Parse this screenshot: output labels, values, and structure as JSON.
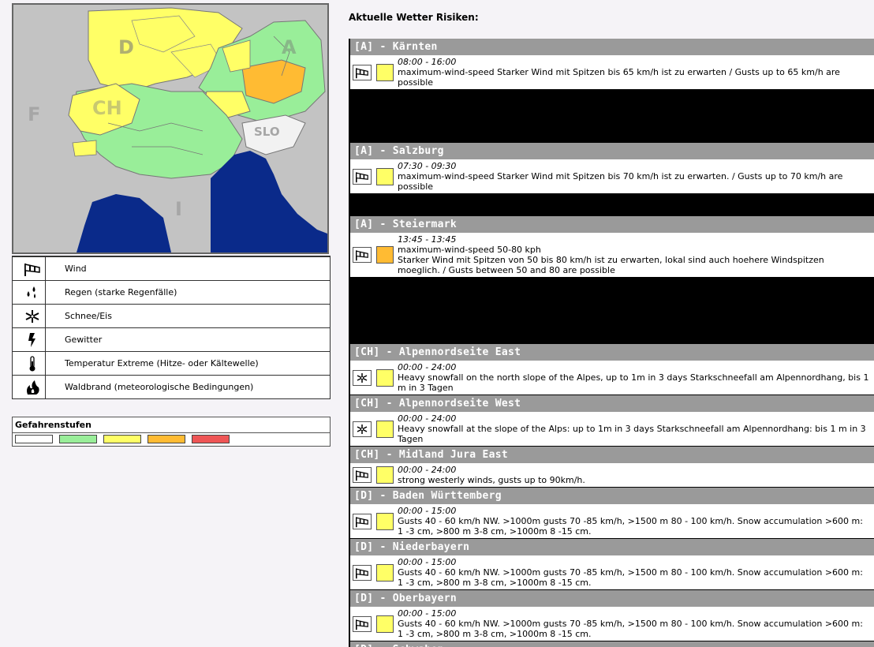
{
  "map": {
    "labels": [
      "D",
      "A",
      "F",
      "CH",
      "SLO",
      "I"
    ]
  },
  "legend": [
    {
      "icon": "windsock-icon",
      "label": "Wind"
    },
    {
      "icon": "rain-icon",
      "label": "Regen (starke Regenfälle)"
    },
    {
      "icon": "snowflake-icon",
      "label": "Schnee/Eis"
    },
    {
      "icon": "lightning-icon",
      "label": "Gewitter"
    },
    {
      "icon": "thermometer-icon",
      "label": "Temperatur Extreme (Hitze- oder Kältewelle)"
    },
    {
      "icon": "forest-fire-icon",
      "label": "Waldbrand (meteorologische Bedingungen)"
    }
  ],
  "levels": {
    "title": "Gefahrenstufen",
    "colors": [
      "#ffffff",
      "#99ee99",
      "#ffff66",
      "#ffbb33",
      "#ee5555"
    ]
  },
  "risks": {
    "title": "Aktuelle Wetter Risiken:",
    "regions": [
      {
        "name": "[A] - Kärnten",
        "icon": "windsock-icon",
        "level_color": "#ffff66",
        "time": "08:00  -  16:00",
        "lines": [
          "maximum-wind-speed Starker Wind mit Spitzen bis 65 km/h ist zu erwarten / Gusts up to 65 km/h are possible"
        ]
      },
      {
        "name": "[A] - Salzburg",
        "icon": "windsock-icon",
        "level_color": "#ffff66",
        "time": "07:30  -  09:30",
        "lines": [
          "maximum-wind-speed Starker Wind mit Spitzen bis 70 km/h ist zu erwarten. / Gusts up to 70 km/h are possible"
        ]
      },
      {
        "name": "[A] - Steiermark",
        "icon": "windsock-icon",
        "level_color": "#ffbb33",
        "time": "13:45  -  13:45",
        "lines": [
          "maximum-wind-speed 50-80 kph",
          "Starker Wind mit Spitzen von 50 bis 80 km/h ist zu erwarten, lokal sind auch hoehere Windspitzen moeglich. / Gusts between 50 and 80 are possible"
        ]
      },
      {
        "name": "[CH] - Alpennordseite East",
        "icon": "snowflake-icon",
        "level_color": "#ffff66",
        "time": "00:00  -  24:00",
        "lines": [
          "Heavy snowfall on the north slope of the Alpes, up to 1m in 3 days Starkschneefall am Alpennordhang, bis 1 m in 3 Tagen"
        ]
      },
      {
        "name": "[CH] - Alpennordseite West",
        "icon": "snowflake-icon",
        "level_color": "#ffff66",
        "time": "00:00  -  24:00",
        "lines": [
          "Heavy snowfall at the slope of the Alps: up to 1m in 3 days Starkschneefall am Alpennordhang: bis 1 m in 3 Tagen"
        ]
      },
      {
        "name": "[CH] - Midland Jura East",
        "icon": "windsock-icon",
        "level_color": "#ffff66",
        "time": "00:00  -  24:00",
        "lines": [
          "strong westerly winds, gusts up to 90km/h."
        ]
      },
      {
        "name": "[D] - Baden Württemberg",
        "icon": "windsock-icon",
        "level_color": "#ffff66",
        "time": "00:00  -  15:00",
        "lines": [
          "Gusts 40 - 60 km/h NW. >1000m gusts 70 -85 km/h, >1500 m 80 - 100 km/h. Snow accumulation >600 m: 1 -3 cm, >800 m 3-8 cm, >1000m 8 -15 cm."
        ]
      },
      {
        "name": "[D] - Niederbayern",
        "icon": "windsock-icon",
        "level_color": "#ffff66",
        "time": "00:00  -  15:00",
        "lines": [
          "Gusts 40 - 60 km/h NW. >1000m gusts 70 -85 km/h, >1500 m 80 - 100 km/h. Snow accumulation >600 m: 1 -3 cm, >800 m 3-8 cm, >1000m 8 -15 cm."
        ]
      },
      {
        "name": "[D] - Oberbayern",
        "icon": "windsock-icon",
        "level_color": "#ffff66",
        "time": "00:00  -  15:00",
        "lines": [
          "Gusts 40 - 60 km/h NW. >1000m gusts 70 -85 km/h, >1500 m 80 - 100 km/h. Snow accumulation >600 m: 1 -3 cm, >800 m 3-8 cm, >1000m 8 -15 cm."
        ]
      },
      {
        "name": "[D] - Schwaben",
        "icon": "windsock-icon",
        "level_color": "#ffff66",
        "time": "",
        "lines": []
      }
    ]
  }
}
